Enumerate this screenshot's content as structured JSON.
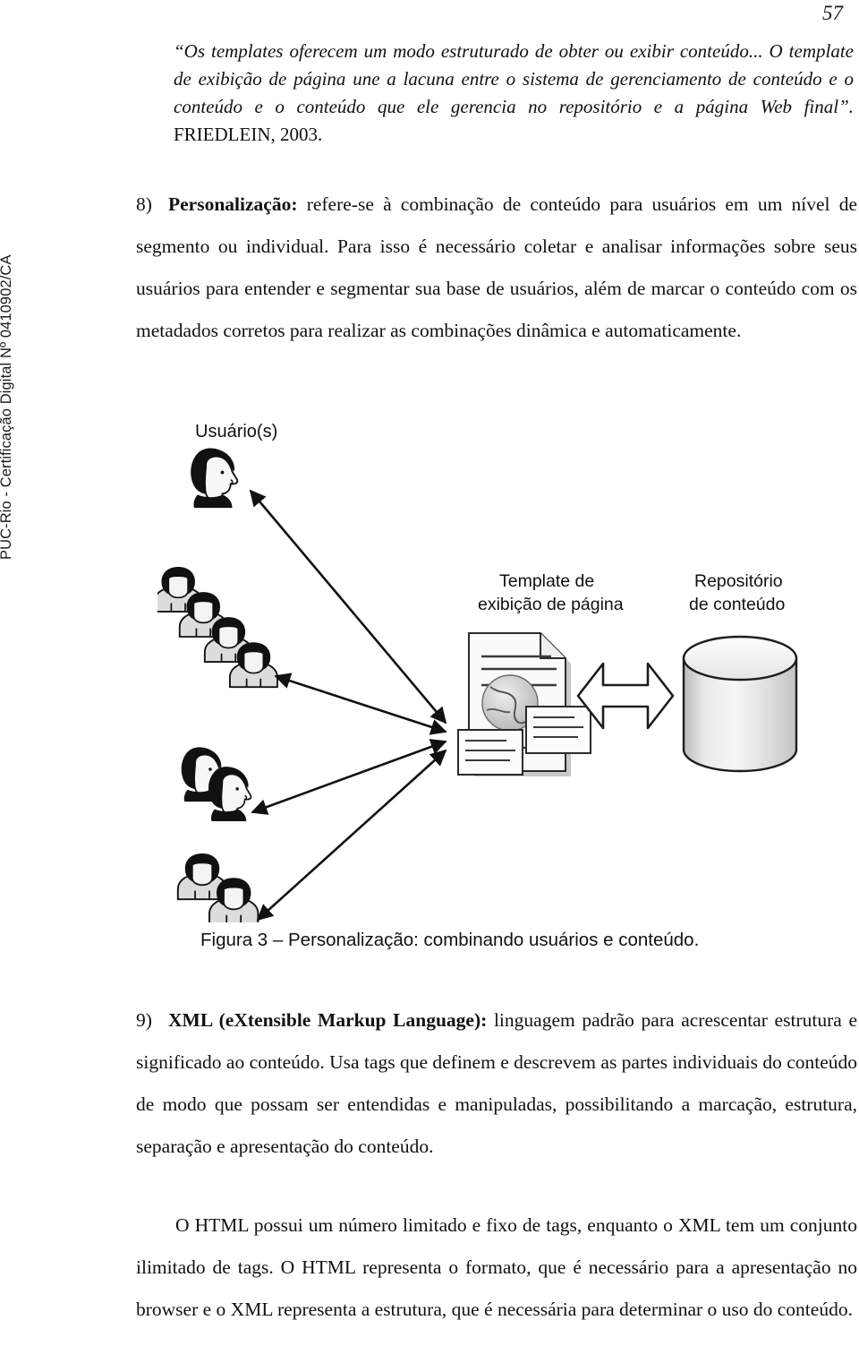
{
  "page": {
    "number": "57",
    "side_stamp": "PUC-Rio - Certificação Digital Nº 0410902/CA"
  },
  "quote": {
    "text": "“Os templates oferecem um modo estruturado de obter ou exibir conteúdo... O template de exibição de página une a lacuna entre o sistema de gerenciamento de conteúdo e o conteúdo e o conteúdo que ele gerencia no repositório e a página Web final”.",
    "citation": " FRIEDLEIN, 2003."
  },
  "item8": {
    "marker": "8)",
    "term": "Personalização:",
    "body": " refere-se à combinação de conteúdo para usuários em um nível de segmento ou individual. Para isso é necessário coletar e analisar informações sobre seus usuários para entender e segmentar sua base de usuários, além de marcar o conteúdo com os metadados corretos para realizar as combinações dinâmica e automaticamente."
  },
  "figure": {
    "label_users": "Usuário(s)",
    "label_template_line1": "Template de",
    "label_template_line2": "exibição de página",
    "label_repository_line1": "Repositório",
    "label_repository_line2": "de conteúdo",
    "caption": "Figura 3 – Personalização: combinando usuários e conteúdo."
  },
  "item9": {
    "marker": "9)",
    "term": "XML (eXtensible Markup Language):",
    "body": " linguagem padrão para acrescentar estrutura e significado ao conteúdo. Usa tags que definem e descrevem as partes individuais do conteúdo de modo que possam ser entendidas e manipuladas, possibilitando a marcação, estrutura, separação e apresentação do conteúdo."
  },
  "paragraph_html": {
    "text": "O HTML possui um número limitado e fixo de tags, enquanto o XML tem um conjunto ilimitado de tags. O HTML representa o formato, que é necessário para a apresentação no browser e o XML representa a estrutura, que é necessária para determinar o uso do conteúdo."
  }
}
